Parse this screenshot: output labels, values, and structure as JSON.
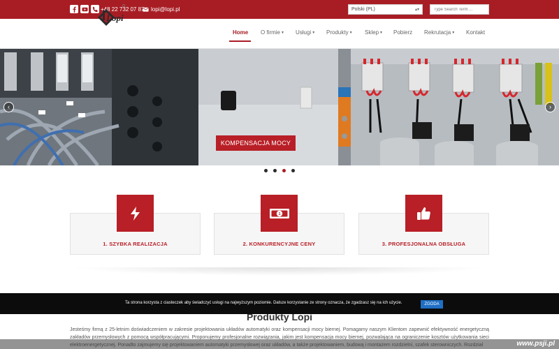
{
  "topbar": {
    "phone": "+48 22 732 07 87",
    "email": "lopi@lopi.pl",
    "language": "Polski (PL)",
    "search_placeholder": "Type Search Term ...",
    "social": [
      "facebook-icon",
      "youtube-icon"
    ],
    "background": "#a81d24"
  },
  "logo": {
    "text": "Lopi"
  },
  "nav": {
    "items": [
      {
        "label": "Home",
        "active": true
      },
      {
        "label": "O firmie",
        "has_dropdown": true
      },
      {
        "label": "Usługi",
        "has_dropdown": true
      },
      {
        "label": "Produkty",
        "has_dropdown": true
      },
      {
        "label": "Sklep",
        "has_dropdown": true
      },
      {
        "label": "Pobierz"
      },
      {
        "label": "Rekrutacja",
        "has_dropdown": true
      },
      {
        "label": "Kontakt"
      }
    ]
  },
  "slider": {
    "caption": "KOMPENSACJA MOCY",
    "slide_count": 4,
    "active_slide": 3,
    "prev": "‹",
    "next": "›"
  },
  "features": [
    {
      "label": "1. SZYBKA REALIZACJA",
      "icon": "lightning-icon"
    },
    {
      "label": "2. KONKURENCYJNE CENY",
      "icon": "banknote-icon"
    },
    {
      "label": "3. PROFESJONALNA OBSŁUGA",
      "icon": "thumbs-up-icon"
    }
  ],
  "section": {
    "title": "Produkty Lopi",
    "paragraph": "Jesteśmy firmą z 25-letnim doświadczeniem w zakresie projektowania układów automatyki oraz kompensacji mocy biernej. Pomagamy naszym Klientom zapewnić efektywność energetyczną zakładów przemysłowych z pomocą współpracującymi. Proponujemy profesjonalne rozwiązania, jakim jest kompensacja mocy biernej, pozwalająca na ograniczenie kosztów użytkowania sieci elektroenergetycznej. Ponadto zajmujemy się projektowaniem automatyki przemysłowej oraz układów, a także projektowaniem, budową i montażem rozdzielni, szafek sterowniczych. Rozdział"
  },
  "cookie": {
    "text": "Ta strona korzysta z ciasteczek aby świadczyć usługi na najwyższym poziomie. Dalsze korzystanie ze strony oznacza, że zgadzasz się na ich użycie.",
    "button": "ZGODA"
  },
  "watermark": "www.psji.pl",
  "colors": {
    "brand": "#a81d24",
    "accent_red": "#b81f26",
    "cookie_button": "#1f6fc5"
  }
}
